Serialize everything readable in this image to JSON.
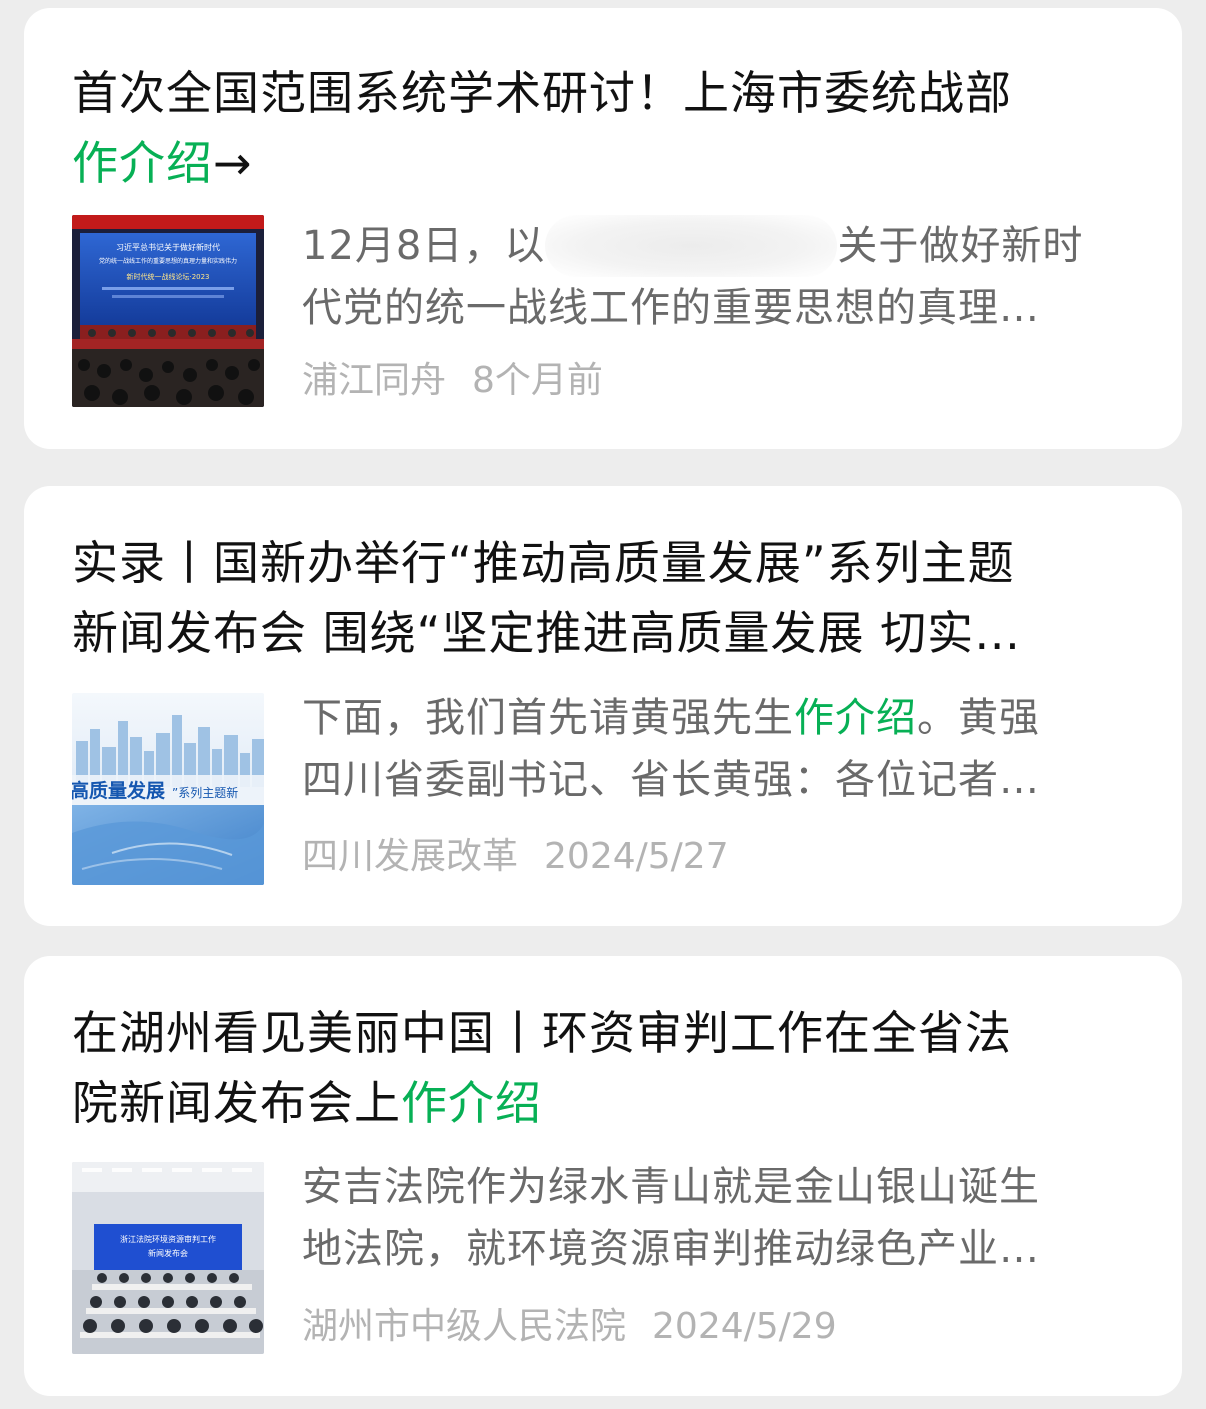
{
  "results": [
    {
      "title_line1": "首次全国范围系统学术研讨！上海市委统战部",
      "title_line2_highlight": "作介绍",
      "title_line2_rest": "→",
      "snippet_line1_before": "12月8日，以",
      "snippet_line1_after": "关于做好新时",
      "snippet_line2": "代党的统一战线工作的重要思想的真理…",
      "source": "浦江同舟",
      "time": "8个月前",
      "thumb_text": {
        "line1": "习近平总书记关于做好新时代",
        "line2": "党的统一战线工作的重要思想的真理力量和实践伟力",
        "line3": "新时代统一战线论坛·2023"
      }
    },
    {
      "title_line1": "实录丨国新办举行“推动高质量发展”系列主题",
      "title_line2": "新闻发布会 围绕“坚定推进高质量发展 切实…",
      "snippet_line1_before": "下面，我们首先请黄强先生",
      "snippet_line1_highlight": "作介绍",
      "snippet_line1_after": "。黄强",
      "snippet_line2": "四川省委副书记、省长黄强：各位记者…",
      "source": "四川发展改革",
      "time": "2024/5/27",
      "thumb_text": {
        "banner_a": "高质量发展",
        "banner_b": "”系列主题新"
      }
    },
    {
      "title_line1": "在湖州看见美丽中国丨环资审判工作在全省法",
      "title_line2_before": "院新闻发布会上",
      "title_line2_highlight": "作介绍",
      "snippet_line1": "安吉法院作为绿水青山就是金山银山诞生",
      "snippet_line2": "地法院，就环境资源审判推动绿色产业…",
      "source": "湖州市中级人民法院",
      "time": "2024/5/29",
      "thumb_text": {
        "line1": "浙江法院环境资源审判工作",
        "line2": "新闻发布会"
      }
    }
  ],
  "colors": {
    "highlight": "#07b055",
    "title": "#111111",
    "snippet": "#6a6a6a",
    "meta": "#b3b3b3",
    "background": "#ededed",
    "card": "#ffffff"
  }
}
